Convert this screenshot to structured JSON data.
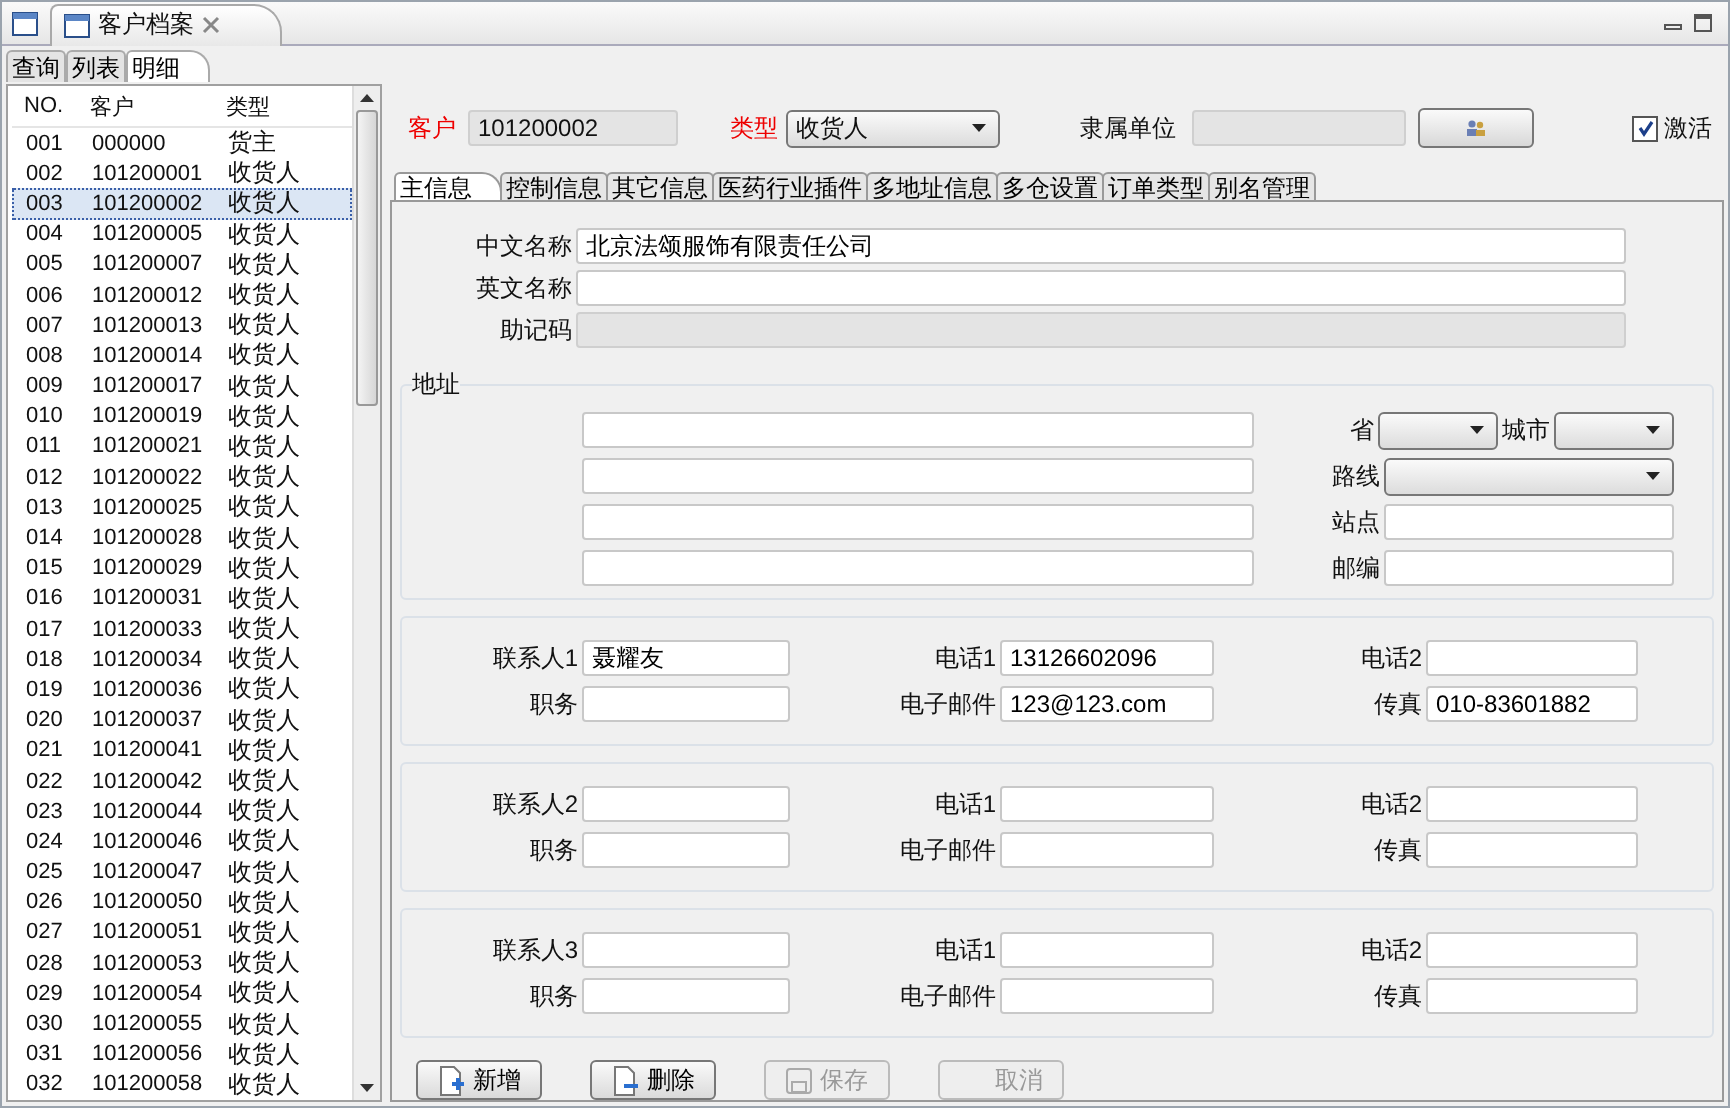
{
  "window": {
    "tab_title": "客户档案"
  },
  "view_tabs": [
    {
      "label": "查询",
      "selected": false
    },
    {
      "label": "列表",
      "selected": false
    },
    {
      "label": "明细",
      "selected": true
    }
  ],
  "list": {
    "columns": [
      "NO.",
      "客户",
      "类型"
    ],
    "rows": [
      {
        "no": "001",
        "customer": "000000",
        "type": "货主",
        "selected": false
      },
      {
        "no": "002",
        "customer": "101200001",
        "type": "收货人",
        "selected": false
      },
      {
        "no": "003",
        "customer": "101200002",
        "type": "收货人",
        "selected": true
      },
      {
        "no": "004",
        "customer": "101200005",
        "type": "收货人",
        "selected": false
      },
      {
        "no": "005",
        "customer": "101200007",
        "type": "收货人",
        "selected": false
      },
      {
        "no": "006",
        "customer": "101200012",
        "type": "收货人",
        "selected": false
      },
      {
        "no": "007",
        "customer": "101200013",
        "type": "收货人",
        "selected": false
      },
      {
        "no": "008",
        "customer": "101200014",
        "type": "收货人",
        "selected": false
      },
      {
        "no": "009",
        "customer": "101200017",
        "type": "收货人",
        "selected": false
      },
      {
        "no": "010",
        "customer": "101200019",
        "type": "收货人",
        "selected": false
      },
      {
        "no": "011",
        "customer": "101200021",
        "type": "收货人",
        "selected": false
      },
      {
        "no": "012",
        "customer": "101200022",
        "type": "收货人",
        "selected": false
      },
      {
        "no": "013",
        "customer": "101200025",
        "type": "收货人",
        "selected": false
      },
      {
        "no": "014",
        "customer": "101200028",
        "type": "收货人",
        "selected": false
      },
      {
        "no": "015",
        "customer": "101200029",
        "type": "收货人",
        "selected": false
      },
      {
        "no": "016",
        "customer": "101200031",
        "type": "收货人",
        "selected": false
      },
      {
        "no": "017",
        "customer": "101200033",
        "type": "收货人",
        "selected": false
      },
      {
        "no": "018",
        "customer": "101200034",
        "type": "收货人",
        "selected": false
      },
      {
        "no": "019",
        "customer": "101200036",
        "type": "收货人",
        "selected": false
      },
      {
        "no": "020",
        "customer": "101200037",
        "type": "收货人",
        "selected": false
      },
      {
        "no": "021",
        "customer": "101200041",
        "type": "收货人",
        "selected": false
      },
      {
        "no": "022",
        "customer": "101200042",
        "type": "收货人",
        "selected": false
      },
      {
        "no": "023",
        "customer": "101200044",
        "type": "收货人",
        "selected": false
      },
      {
        "no": "024",
        "customer": "101200046",
        "type": "收货人",
        "selected": false
      },
      {
        "no": "025",
        "customer": "101200047",
        "type": "收货人",
        "selected": false
      },
      {
        "no": "026",
        "customer": "101200050",
        "type": "收货人",
        "selected": false
      },
      {
        "no": "027",
        "customer": "101200051",
        "type": "收货人",
        "selected": false
      },
      {
        "no": "028",
        "customer": "101200053",
        "type": "收货人",
        "selected": false
      },
      {
        "no": "029",
        "customer": "101200054",
        "type": "收货人",
        "selected": false
      },
      {
        "no": "030",
        "customer": "101200055",
        "type": "收货人",
        "selected": false
      },
      {
        "no": "031",
        "customer": "101200056",
        "type": "收货人",
        "selected": false
      },
      {
        "no": "032",
        "customer": "101200058",
        "type": "收货人",
        "selected": false
      }
    ]
  },
  "header": {
    "customer_label": "客户",
    "customer_value": "101200002",
    "type_label": "类型",
    "type_value": "收货人",
    "parent_label": "隶属单位",
    "active": {
      "label": "激活",
      "checked": true
    }
  },
  "detail_tabs": [
    {
      "label": "主信息",
      "selected": true
    },
    {
      "label": "控制信息",
      "selected": false
    },
    {
      "label": "其它信息",
      "selected": false
    },
    {
      "label": "医药行业插件",
      "selected": false
    },
    {
      "label": "多地址信息",
      "selected": false
    },
    {
      "label": "多仓设置",
      "selected": false
    },
    {
      "label": "订单类型",
      "selected": false
    },
    {
      "label": "别名管理",
      "selected": false
    }
  ],
  "names": [
    {
      "label": "中文名称",
      "value": "北京法颂服饰有限责任公司",
      "disabled": false
    },
    {
      "label": "英文名称",
      "disabled": false
    },
    {
      "label": "助记码",
      "disabled": true
    }
  ],
  "address": {
    "title": "地址",
    "province_label": "省",
    "city_label": "城市",
    "route_label": "路线",
    "station_label": "站点",
    "zip_label": "邮编"
  },
  "contacts": [
    {
      "fields": [
        {
          "label": "联系人1",
          "value": "聂耀友"
        },
        {
          "label": "电话1",
          "value": "13126602096"
        },
        {
          "label": "电话2"
        },
        {
          "label": "职务"
        },
        {
          "label": "电子邮件",
          "value": "123@123.com"
        },
        {
          "label": "传真",
          "value": "010-83601882"
        }
      ]
    },
    {
      "fields": [
        {
          "label": "联系人2"
        },
        {
          "label": "电话1"
        },
        {
          "label": "电话2"
        },
        {
          "label": "职务"
        },
        {
          "label": "电子邮件"
        },
        {
          "label": "传真"
        }
      ]
    },
    {
      "fields": [
        {
          "label": "联系人3"
        },
        {
          "label": "电话1"
        },
        {
          "label": "电话2"
        },
        {
          "label": "职务"
        },
        {
          "label": "电子邮件"
        },
        {
          "label": "传真"
        }
      ]
    }
  ],
  "buttons": [
    {
      "label": "新增",
      "kind": "add",
      "disabled": false
    },
    {
      "label": "删除",
      "kind": "delete",
      "disabled": false
    },
    {
      "label": "保存",
      "kind": "save",
      "disabled": true
    },
    {
      "label": "取消",
      "kind": "cancel",
      "disabled": true
    }
  ]
}
